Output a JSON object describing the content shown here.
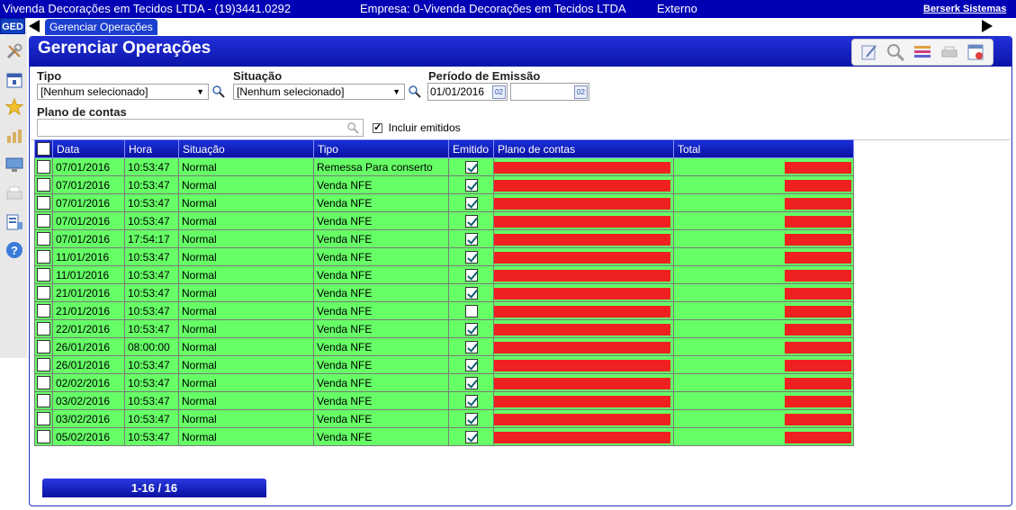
{
  "topbar": {
    "company": "Vivenda Decorações em Tecidos LTDA - (19)3441.0292",
    "empresa": "Empresa: 0-Vivenda Decorações em Tecidos LTDA",
    "modo": "Externo",
    "link": "Berserk Sistemas"
  },
  "nav": {
    "ged_label": "GED",
    "tab_label": "Gerenciar Operações"
  },
  "page": {
    "title": "Gerenciar Operações"
  },
  "filters": {
    "tipo_label": "Tipo",
    "tipo_value": "[Nenhum selecionado]",
    "situacao_label": "Situação",
    "situacao_value": "[Nenhum selecionado]",
    "periodo_label": "Período de Emissão",
    "periodo_inicio": "01/01/2016",
    "periodo_fim": "",
    "calendar_glyph": "02",
    "plano_label": "Plano de contas",
    "plano_value": "",
    "incluir_label": "Incluir emitidos",
    "incluir_checked": true
  },
  "table": {
    "columns": [
      "Data",
      "Hora",
      "Situação",
      "Tipo",
      "Emitido",
      "Plano de contas",
      "Total"
    ],
    "rows": [
      {
        "data": "07/01/2016",
        "hora": "10:53:47",
        "situacao": "Normal",
        "tipo": "Remessa Para conserto",
        "emitido": true
      },
      {
        "data": "07/01/2016",
        "hora": "10:53:47",
        "situacao": "Normal",
        "tipo": "Venda NFE",
        "emitido": true
      },
      {
        "data": "07/01/2016",
        "hora": "10:53:47",
        "situacao": "Normal",
        "tipo": "Venda NFE",
        "emitido": true
      },
      {
        "data": "07/01/2016",
        "hora": "10:53:47",
        "situacao": "Normal",
        "tipo": "Venda NFE",
        "emitido": true
      },
      {
        "data": "07/01/2016",
        "hora": "17:54:17",
        "situacao": "Normal",
        "tipo": "Venda NFE",
        "emitido": true
      },
      {
        "data": "11/01/2016",
        "hora": "10:53:47",
        "situacao": "Normal",
        "tipo": "Venda NFE",
        "emitido": true
      },
      {
        "data": "11/01/2016",
        "hora": "10:53:47",
        "situacao": "Normal",
        "tipo": "Venda NFE",
        "emitido": true
      },
      {
        "data": "21/01/2016",
        "hora": "10:53:47",
        "situacao": "Normal",
        "tipo": "Venda NFE",
        "emitido": true
      },
      {
        "data": "21/01/2016",
        "hora": "10:53:47",
        "situacao": "Normal",
        "tipo": "Venda NFE",
        "emitido": false
      },
      {
        "data": "22/01/2016",
        "hora": "10:53:47",
        "situacao": "Normal",
        "tipo": "Venda NFE",
        "emitido": true
      },
      {
        "data": "26/01/2016",
        "hora": "08:00:00",
        "situacao": "Normal",
        "tipo": "Venda NFE",
        "emitido": true
      },
      {
        "data": "26/01/2016",
        "hora": "10:53:47",
        "situacao": "Normal",
        "tipo": "Venda NFE",
        "emitido": true
      },
      {
        "data": "02/02/2016",
        "hora": "10:53:47",
        "situacao": "Normal",
        "tipo": "Venda NFE",
        "emitido": true
      },
      {
        "data": "03/02/2016",
        "hora": "10:53:47",
        "situacao": "Normal",
        "tipo": "Venda NFE",
        "emitido": true
      },
      {
        "data": "03/02/2016",
        "hora": "10:53:47",
        "situacao": "Normal",
        "tipo": "Venda NFE",
        "emitido": true
      },
      {
        "data": "05/02/2016",
        "hora": "10:53:47",
        "situacao": "Normal",
        "tipo": "Venda NFE",
        "emitido": true
      }
    ]
  },
  "pager": {
    "label": "1-16 / 16"
  },
  "colors": {
    "row_bg": "#66ff66",
    "header_blue": "#0000b4",
    "redacted": "#ee2020"
  },
  "icons": {
    "sidebar": [
      "tools-icon",
      "calendar-icon",
      "star-icon",
      "chart-icon",
      "monitor-icon",
      "printer-icon",
      "report-icon",
      "help-icon"
    ],
    "toolbar": [
      "edit-icon",
      "search-icon",
      "list-icon",
      "print-icon",
      "close-window-icon"
    ]
  }
}
